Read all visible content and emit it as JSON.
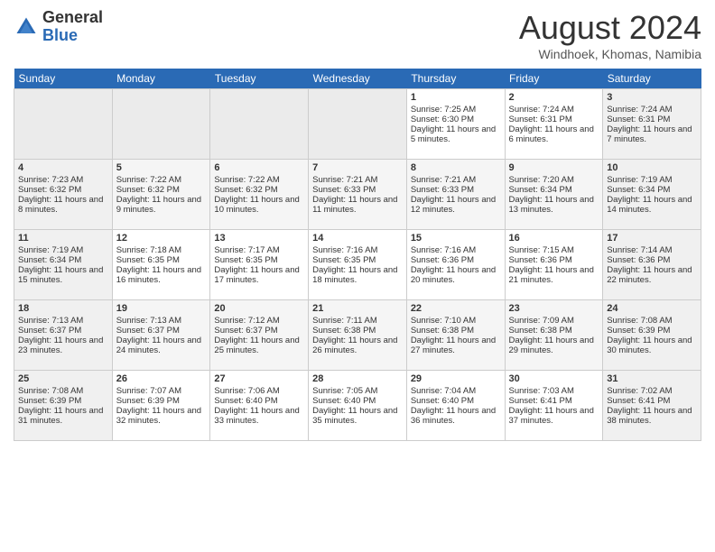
{
  "header": {
    "logo_general": "General",
    "logo_blue": "Blue",
    "month_title": "August 2024",
    "location": "Windhoek, Khomas, Namibia"
  },
  "days_of_week": [
    "Sunday",
    "Monday",
    "Tuesday",
    "Wednesday",
    "Thursday",
    "Friday",
    "Saturday"
  ],
  "weeks": [
    [
      {
        "day": "",
        "empty": true
      },
      {
        "day": "",
        "empty": true
      },
      {
        "day": "",
        "empty": true
      },
      {
        "day": "",
        "empty": true
      },
      {
        "day": "1",
        "sunrise": "7:25 AM",
        "sunset": "6:30 PM",
        "daylight": "11 hours and 5 minutes."
      },
      {
        "day": "2",
        "sunrise": "7:24 AM",
        "sunset": "6:31 PM",
        "daylight": "11 hours and 6 minutes."
      },
      {
        "day": "3",
        "sunrise": "7:24 AM",
        "sunset": "6:31 PM",
        "daylight": "11 hours and 7 minutes."
      }
    ],
    [
      {
        "day": "4",
        "sunrise": "7:23 AM",
        "sunset": "6:32 PM",
        "daylight": "11 hours and 8 minutes."
      },
      {
        "day": "5",
        "sunrise": "7:22 AM",
        "sunset": "6:32 PM",
        "daylight": "11 hours and 9 minutes."
      },
      {
        "day": "6",
        "sunrise": "7:22 AM",
        "sunset": "6:32 PM",
        "daylight": "11 hours and 10 minutes."
      },
      {
        "day": "7",
        "sunrise": "7:21 AM",
        "sunset": "6:33 PM",
        "daylight": "11 hours and 11 minutes."
      },
      {
        "day": "8",
        "sunrise": "7:21 AM",
        "sunset": "6:33 PM",
        "daylight": "11 hours and 12 minutes."
      },
      {
        "day": "9",
        "sunrise": "7:20 AM",
        "sunset": "6:34 PM",
        "daylight": "11 hours and 13 minutes."
      },
      {
        "day": "10",
        "sunrise": "7:19 AM",
        "sunset": "6:34 PM",
        "daylight": "11 hours and 14 minutes."
      }
    ],
    [
      {
        "day": "11",
        "sunrise": "7:19 AM",
        "sunset": "6:34 PM",
        "daylight": "11 hours and 15 minutes."
      },
      {
        "day": "12",
        "sunrise": "7:18 AM",
        "sunset": "6:35 PM",
        "daylight": "11 hours and 16 minutes."
      },
      {
        "day": "13",
        "sunrise": "7:17 AM",
        "sunset": "6:35 PM",
        "daylight": "11 hours and 17 minutes."
      },
      {
        "day": "14",
        "sunrise": "7:16 AM",
        "sunset": "6:35 PM",
        "daylight": "11 hours and 18 minutes."
      },
      {
        "day": "15",
        "sunrise": "7:16 AM",
        "sunset": "6:36 PM",
        "daylight": "11 hours and 20 minutes."
      },
      {
        "day": "16",
        "sunrise": "7:15 AM",
        "sunset": "6:36 PM",
        "daylight": "11 hours and 21 minutes."
      },
      {
        "day": "17",
        "sunrise": "7:14 AM",
        "sunset": "6:36 PM",
        "daylight": "11 hours and 22 minutes."
      }
    ],
    [
      {
        "day": "18",
        "sunrise": "7:13 AM",
        "sunset": "6:37 PM",
        "daylight": "11 hours and 23 minutes."
      },
      {
        "day": "19",
        "sunrise": "7:13 AM",
        "sunset": "6:37 PM",
        "daylight": "11 hours and 24 minutes."
      },
      {
        "day": "20",
        "sunrise": "7:12 AM",
        "sunset": "6:37 PM",
        "daylight": "11 hours and 25 minutes."
      },
      {
        "day": "21",
        "sunrise": "7:11 AM",
        "sunset": "6:38 PM",
        "daylight": "11 hours and 26 minutes."
      },
      {
        "day": "22",
        "sunrise": "7:10 AM",
        "sunset": "6:38 PM",
        "daylight": "11 hours and 27 minutes."
      },
      {
        "day": "23",
        "sunrise": "7:09 AM",
        "sunset": "6:38 PM",
        "daylight": "11 hours and 29 minutes."
      },
      {
        "day": "24",
        "sunrise": "7:08 AM",
        "sunset": "6:39 PM",
        "daylight": "11 hours and 30 minutes."
      }
    ],
    [
      {
        "day": "25",
        "sunrise": "7:08 AM",
        "sunset": "6:39 PM",
        "daylight": "11 hours and 31 minutes."
      },
      {
        "day": "26",
        "sunrise": "7:07 AM",
        "sunset": "6:39 PM",
        "daylight": "11 hours and 32 minutes."
      },
      {
        "day": "27",
        "sunrise": "7:06 AM",
        "sunset": "6:40 PM",
        "daylight": "11 hours and 33 minutes."
      },
      {
        "day": "28",
        "sunrise": "7:05 AM",
        "sunset": "6:40 PM",
        "daylight": "11 hours and 35 minutes."
      },
      {
        "day": "29",
        "sunrise": "7:04 AM",
        "sunset": "6:40 PM",
        "daylight": "11 hours and 36 minutes."
      },
      {
        "day": "30",
        "sunrise": "7:03 AM",
        "sunset": "6:41 PM",
        "daylight": "11 hours and 37 minutes."
      },
      {
        "day": "31",
        "sunrise": "7:02 AM",
        "sunset": "6:41 PM",
        "daylight": "11 hours and 38 minutes."
      }
    ]
  ],
  "labels": {
    "sunrise_prefix": "Sunrise: ",
    "sunset_prefix": "Sunset: ",
    "daylight_prefix": "Daylight: "
  }
}
